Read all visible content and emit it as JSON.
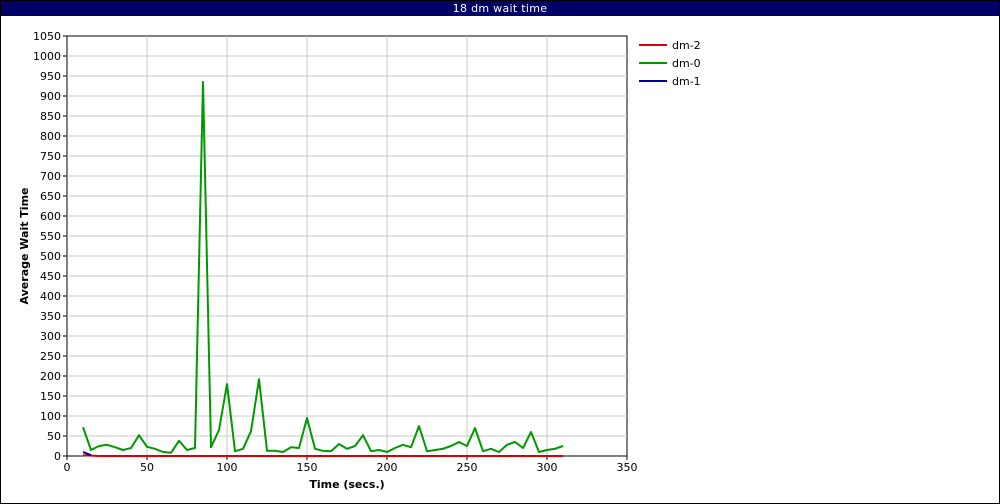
{
  "window": {
    "title": "18 dm wait time"
  },
  "chart_data": {
    "type": "line",
    "title": "18 dm wait time",
    "xlabel": "Time (secs.)",
    "ylabel": "Average Wait Time",
    "xlim": [
      0,
      350
    ],
    "ylim": [
      0,
      1050
    ],
    "x_ticks": [
      0,
      50,
      100,
      150,
      200,
      250,
      300,
      350
    ],
    "y_ticks": [
      0,
      50,
      100,
      150,
      200,
      250,
      300,
      350,
      400,
      450,
      500,
      550,
      600,
      650,
      700,
      750,
      800,
      850,
      900,
      950,
      1000,
      1050
    ],
    "grid": true,
    "legend_position": "top-right",
    "series": [
      {
        "name": "dm-2",
        "color": "#dd0000",
        "x": [
          10,
          15,
          20,
          30,
          50,
          100,
          150,
          200,
          250,
          300,
          310
        ],
        "y": [
          2,
          1,
          0,
          0,
          0,
          0,
          0,
          0,
          0,
          0,
          0
        ]
      },
      {
        "name": "dm-0",
        "color": "#009900",
        "x": [
          10,
          15,
          20,
          25,
          30,
          35,
          40,
          45,
          50,
          55,
          60,
          65,
          70,
          75,
          80,
          85,
          90,
          95,
          100,
          105,
          110,
          115,
          120,
          125,
          130,
          135,
          140,
          145,
          150,
          155,
          160,
          165,
          170,
          175,
          180,
          185,
          190,
          195,
          200,
          205,
          210,
          215,
          220,
          225,
          230,
          235,
          240,
          245,
          250,
          255,
          260,
          265,
          270,
          275,
          280,
          285,
          290,
          295,
          300,
          305,
          310
        ],
        "y": [
          72,
          15,
          25,
          28,
          22,
          15,
          20,
          52,
          23,
          18,
          10,
          8,
          38,
          15,
          20,
          935,
          22,
          65,
          180,
          12,
          18,
          62,
          192,
          13,
          13,
          10,
          22,
          20,
          95,
          18,
          13,
          12,
          30,
          18,
          25,
          52,
          12,
          15,
          10,
          20,
          28,
          22,
          75,
          12,
          15,
          18,
          25,
          35,
          25,
          70,
          12,
          18,
          10,
          28,
          35,
          20,
          60,
          10,
          15,
          18,
          25
        ]
      },
      {
        "name": "dm-1",
        "color": "#000099",
        "x": [
          10,
          15
        ],
        "y": [
          10,
          2
        ]
      }
    ]
  }
}
